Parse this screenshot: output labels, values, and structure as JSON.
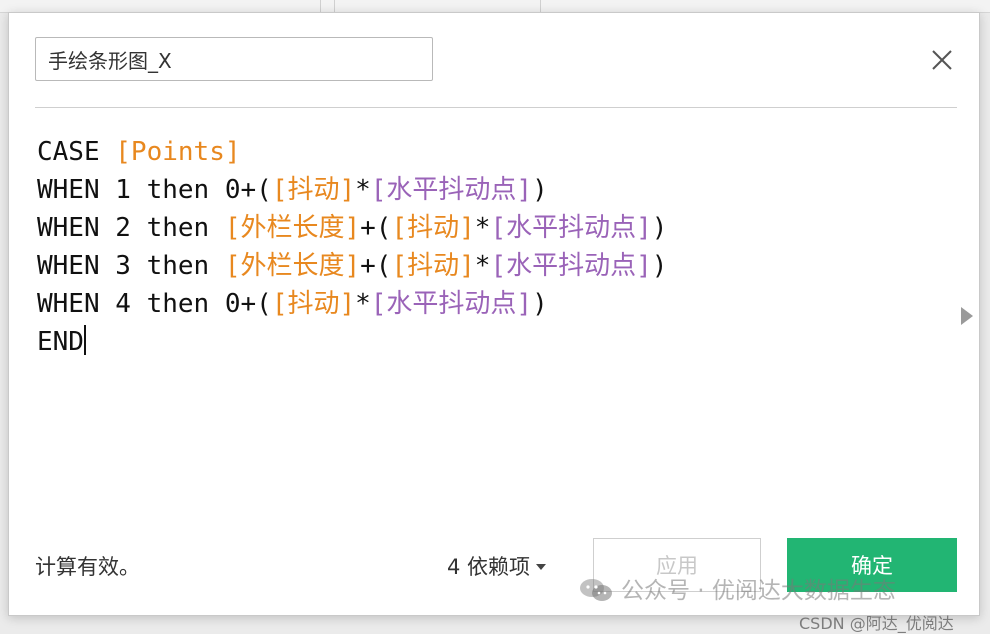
{
  "dialog": {
    "name_value": "手绘条形图_X",
    "close_icon": "close-icon"
  },
  "formula": {
    "lines": [
      [
        {
          "t": "CASE ",
          "c": "kw"
        },
        {
          "t": "[Points]",
          "c": "fld"
        }
      ],
      [
        {
          "t": "WHEN 1 then 0+(",
          "c": "kw"
        },
        {
          "t": "[抖动]",
          "c": "fld"
        },
        {
          "t": "*",
          "c": "op"
        },
        {
          "t": "[水平抖动点]",
          "c": "param"
        },
        {
          "t": ")",
          "c": "op"
        }
      ],
      [
        {
          "t": "WHEN 2 then ",
          "c": "kw"
        },
        {
          "t": "[外栏长度]",
          "c": "fld"
        },
        {
          "t": "+(",
          "c": "op"
        },
        {
          "t": "[抖动]",
          "c": "fld"
        },
        {
          "t": "*",
          "c": "op"
        },
        {
          "t": "[水平抖动点]",
          "c": "param"
        },
        {
          "t": ")",
          "c": "op"
        }
      ],
      [
        {
          "t": "WHEN 3 then ",
          "c": "kw"
        },
        {
          "t": "[外栏长度]",
          "c": "fld"
        },
        {
          "t": "+(",
          "c": "op"
        },
        {
          "t": "[抖动]",
          "c": "fld"
        },
        {
          "t": "*",
          "c": "op"
        },
        {
          "t": "[水平抖动点]",
          "c": "param"
        },
        {
          "t": ")",
          "c": "op"
        }
      ],
      [
        {
          "t": "WHEN 4 then 0+(",
          "c": "kw"
        },
        {
          "t": "[抖动]",
          "c": "fld"
        },
        {
          "t": "*",
          "c": "op"
        },
        {
          "t": "[水平抖动点]",
          "c": "param"
        },
        {
          "t": ")",
          "c": "op"
        }
      ],
      [
        {
          "t": "END",
          "c": "kw"
        }
      ]
    ],
    "colors": {
      "keyword": "#111111",
      "field": "#e8881f",
      "parameter": "#9a63b8"
    }
  },
  "footer": {
    "status": "计算有效。",
    "dependencies": "4 依赖项",
    "apply_label": "应用",
    "ok_label": "确定",
    "ok_color": "#22b573"
  },
  "watermark": {
    "text": "公众号 · 优阅达大数据生态",
    "credit": "CSDN @阿达_优阅达"
  }
}
